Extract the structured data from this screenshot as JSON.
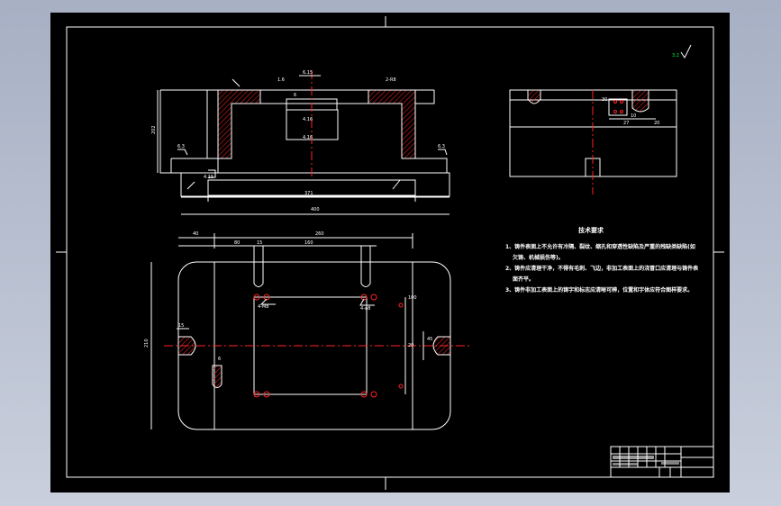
{
  "drawing": {
    "tech_requirements": {
      "title": "技术要求",
      "items": [
        "1、铸件表面上不允许有冷隔、裂纹、缩孔和穿透性缺陷及严重的残缺类缺陷(如",
        "欠铸、机械损伤等)。",
        "2、铸件应清理干净，不得有毛刺、飞边，非加工表面上的浇冒口应清理与铸件表",
        "面齐平。",
        "3、铸件非加工表面上的铸字和标志应清晰可辨，位置和字体应符合图样要求。"
      ]
    },
    "surface_mark": "3.2",
    "front_view_dims": {
      "overall_width": "400",
      "inner_width": "371",
      "left_height": "202",
      "top_dims": [
        "6.15",
        "1.6",
        "2-R8",
        "6",
        "4.16",
        "4.16",
        "4.15"
      ],
      "left_labels": [
        "6.3",
        "6.3"
      ]
    },
    "plan_view_dims": {
      "top_dims": [
        "40",
        "260",
        "80",
        "15",
        "160"
      ],
      "right_dims": [
        "100",
        "20",
        "45"
      ],
      "left_dims": [
        "210",
        "15"
      ],
      "hole_labels": [
        "4-M8",
        "4-φ8"
      ],
      "small_label": "6"
    },
    "side_view_dims": {
      "labels": [
        "27",
        "10",
        "20",
        "30"
      ]
    }
  },
  "colors": {
    "line": "#ffffff",
    "center_line": "#ff2222",
    "mark": "#00ff44",
    "background": "#000000"
  }
}
